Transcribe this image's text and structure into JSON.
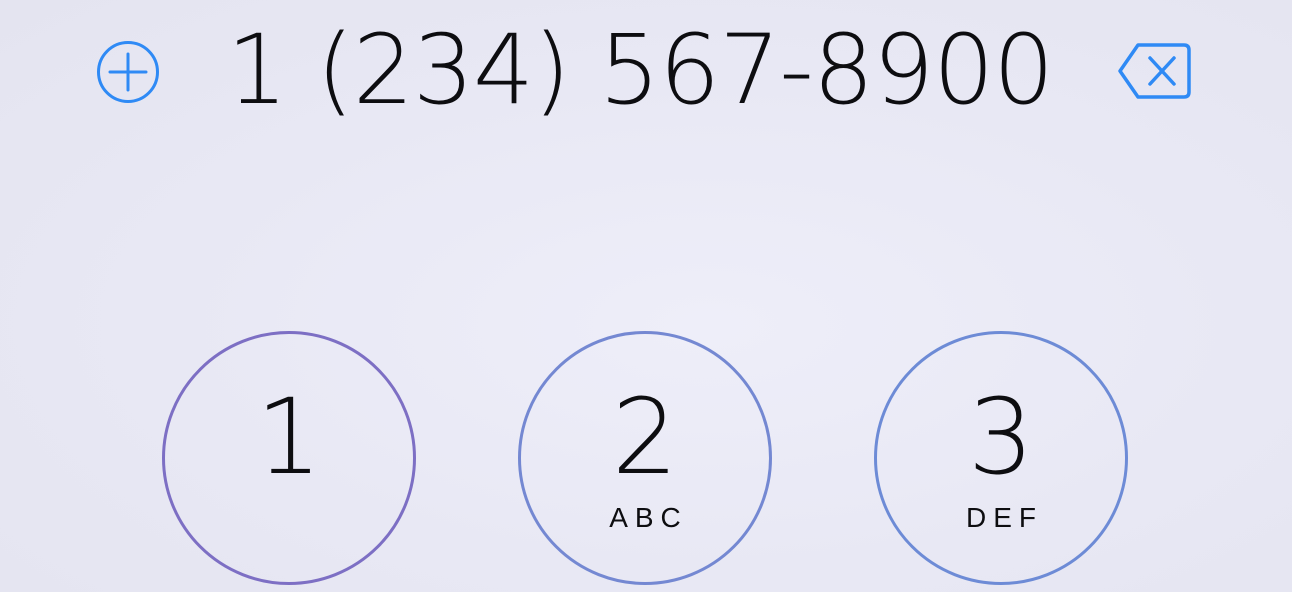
{
  "display": {
    "phone_number": "1 (234) 567-8900"
  },
  "icons": {
    "add_contact": "plus-circle-icon",
    "delete": "backspace-icon"
  },
  "colors": {
    "accent": "#2f8af5",
    "key_outline": "#7a86cf",
    "text": "#0d0d10"
  },
  "keypad": {
    "keys": [
      {
        "digit": "1",
        "letters": ""
      },
      {
        "digit": "2",
        "letters": "ABC"
      },
      {
        "digit": "3",
        "letters": "DEF"
      }
    ]
  }
}
